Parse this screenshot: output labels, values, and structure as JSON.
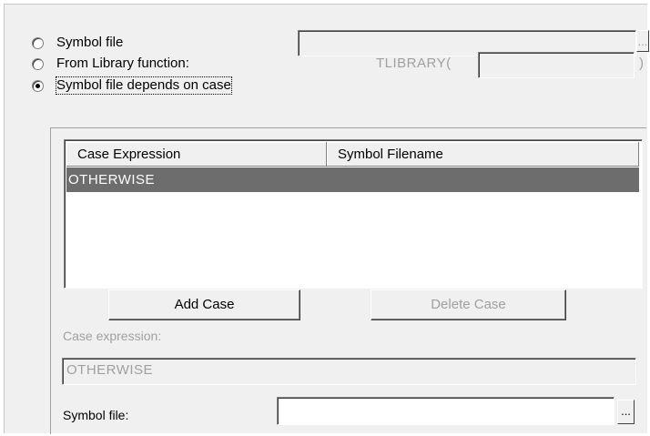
{
  "options": {
    "symbol_file": {
      "label": "Symbol file",
      "checked": false
    },
    "from_library": {
      "label": "From Library function:",
      "checked": false,
      "tlibrary_label": "TLIBRARY(",
      "tlibrary_close": ")"
    },
    "depends_on_case": {
      "label": "Symbol file depends on case",
      "checked": true
    }
  },
  "symbol_file_browse": "...",
  "case_table": {
    "columns": [
      "Case Expression",
      "Symbol Filename"
    ],
    "rows": [
      {
        "case_expression": "OTHERWISE",
        "symbol_filename": "",
        "selected": true
      }
    ]
  },
  "buttons": {
    "add_case": "Add Case",
    "delete_case": "Delete Case"
  },
  "case_expression": {
    "label": "Case expression:",
    "value": "OTHERWISE"
  },
  "symbol_file_field": {
    "label": "Symbol file:",
    "value": "",
    "browse": "..."
  }
}
